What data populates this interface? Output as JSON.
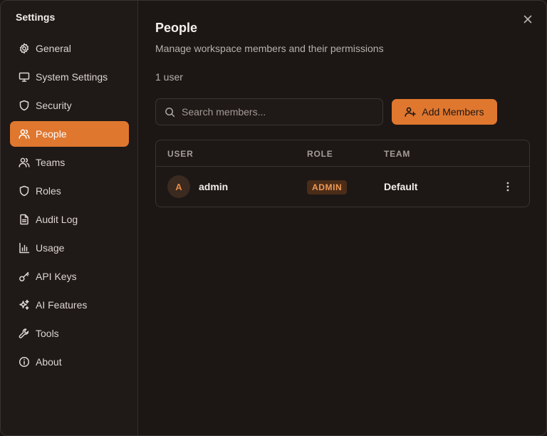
{
  "sidebar": {
    "title": "Settings",
    "items": [
      {
        "label": "General",
        "icon": "gear-icon"
      },
      {
        "label": "System Settings",
        "icon": "monitor-icon"
      },
      {
        "label": "Security",
        "icon": "shield-icon"
      },
      {
        "label": "People",
        "icon": "users-icon",
        "active": true
      },
      {
        "label": "Teams",
        "icon": "team-icon"
      },
      {
        "label": "Roles",
        "icon": "shield-icon"
      },
      {
        "label": "Audit Log",
        "icon": "document-icon"
      },
      {
        "label": "Usage",
        "icon": "bar-chart-icon"
      },
      {
        "label": "API Keys",
        "icon": "key-icon"
      },
      {
        "label": "AI Features",
        "icon": "sparkles-icon"
      },
      {
        "label": "Tools",
        "icon": "wrench-icon"
      },
      {
        "label": "About",
        "icon": "info-icon"
      }
    ]
  },
  "main": {
    "title": "People",
    "subtitle": "Manage workspace members and their permissions",
    "user_count": "1 user",
    "search": {
      "placeholder": "Search members...",
      "value": ""
    },
    "add_button": "Add Members",
    "table": {
      "columns": [
        "USER",
        "ROLE",
        "TEAM"
      ],
      "rows": [
        {
          "avatar": "A",
          "user": "admin",
          "role": "ADMIN",
          "team": "Default"
        }
      ]
    }
  },
  "colors": {
    "accent": "#e0772f",
    "background": "#1c1715",
    "sidebar_background": "#1f1917",
    "badge_background": "#4a2c18",
    "badge_text": "#ee9a55"
  }
}
